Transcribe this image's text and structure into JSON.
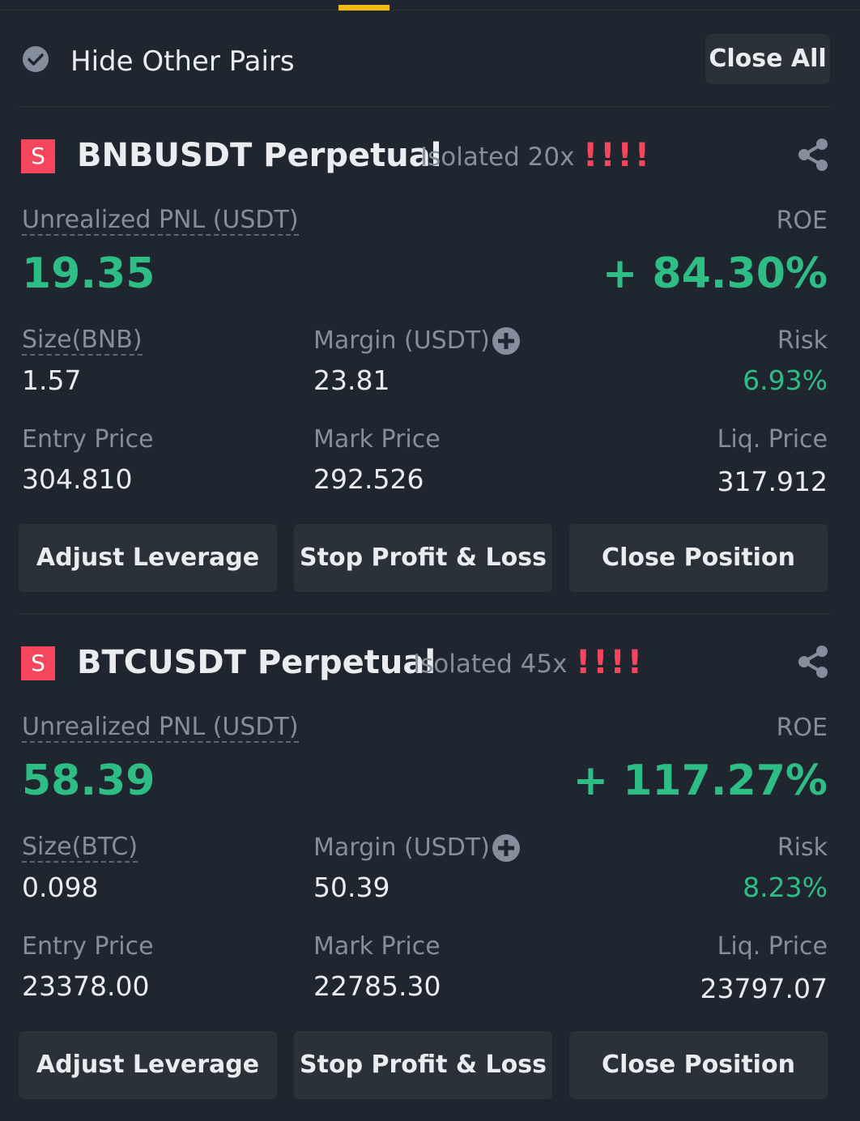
{
  "header": {
    "hide_other_pairs_label": "Hide Other Pairs",
    "close_all_label": "Close All"
  },
  "positions": [
    {
      "side_badge": "S",
      "symbol": "BNBUSDT Perpetual",
      "margin_mode": "Isolated 20x",
      "alert": "!!!!",
      "pnl_label": "Unrealized PNL (USDT)",
      "pnl_value": "19.35",
      "roe_label": "ROE",
      "roe_value": "+ 84.30%",
      "size_label": "Size(BNB)",
      "size_value": "1.57",
      "margin_label": "Margin (USDT)",
      "margin_value": "23.81",
      "risk_label": "Risk",
      "risk_value": "6.93%",
      "entry_label": "Entry Price",
      "entry_value": "304.810",
      "mark_label": "Mark Price",
      "mark_value": "292.526",
      "liq_label": "Liq. Price",
      "liq_value": "317.912",
      "adjust_leverage_label": "Adjust Leverage",
      "stop_profit_loss_label": "Stop Profit & Loss",
      "close_position_label": "Close Position"
    },
    {
      "side_badge": "S",
      "symbol": "BTCUSDT Perpetual",
      "margin_mode": "Isolated 45x",
      "alert": "!!!!",
      "pnl_label": "Unrealized PNL (USDT)",
      "pnl_value": "58.39",
      "roe_label": "ROE",
      "roe_value": "+ 117.27%",
      "size_label": "Size(BTC)",
      "size_value": "0.098",
      "margin_label": "Margin (USDT)",
      "margin_value": "50.39",
      "risk_label": "Risk",
      "risk_value": "8.23%",
      "entry_label": "Entry Price",
      "entry_value": "23378.00",
      "mark_label": "Mark Price",
      "mark_value": "22785.30",
      "liq_label": "Liq. Price",
      "liq_value": "23797.07",
      "adjust_leverage_label": "Adjust Leverage",
      "stop_profit_loss_label": "Stop Profit & Loss",
      "close_position_label": "Close Position"
    }
  ],
  "colors": {
    "background": "#1f2630",
    "positive": "#2ebd85",
    "negative": "#f6465d",
    "accent": "#f0b90b",
    "muted_text": "#848e9c",
    "button_bg": "#2b3139"
  },
  "icons": {
    "hide_toggle": "check-circle-icon",
    "share": "share-icon",
    "add_margin": "plus-circle-icon"
  }
}
